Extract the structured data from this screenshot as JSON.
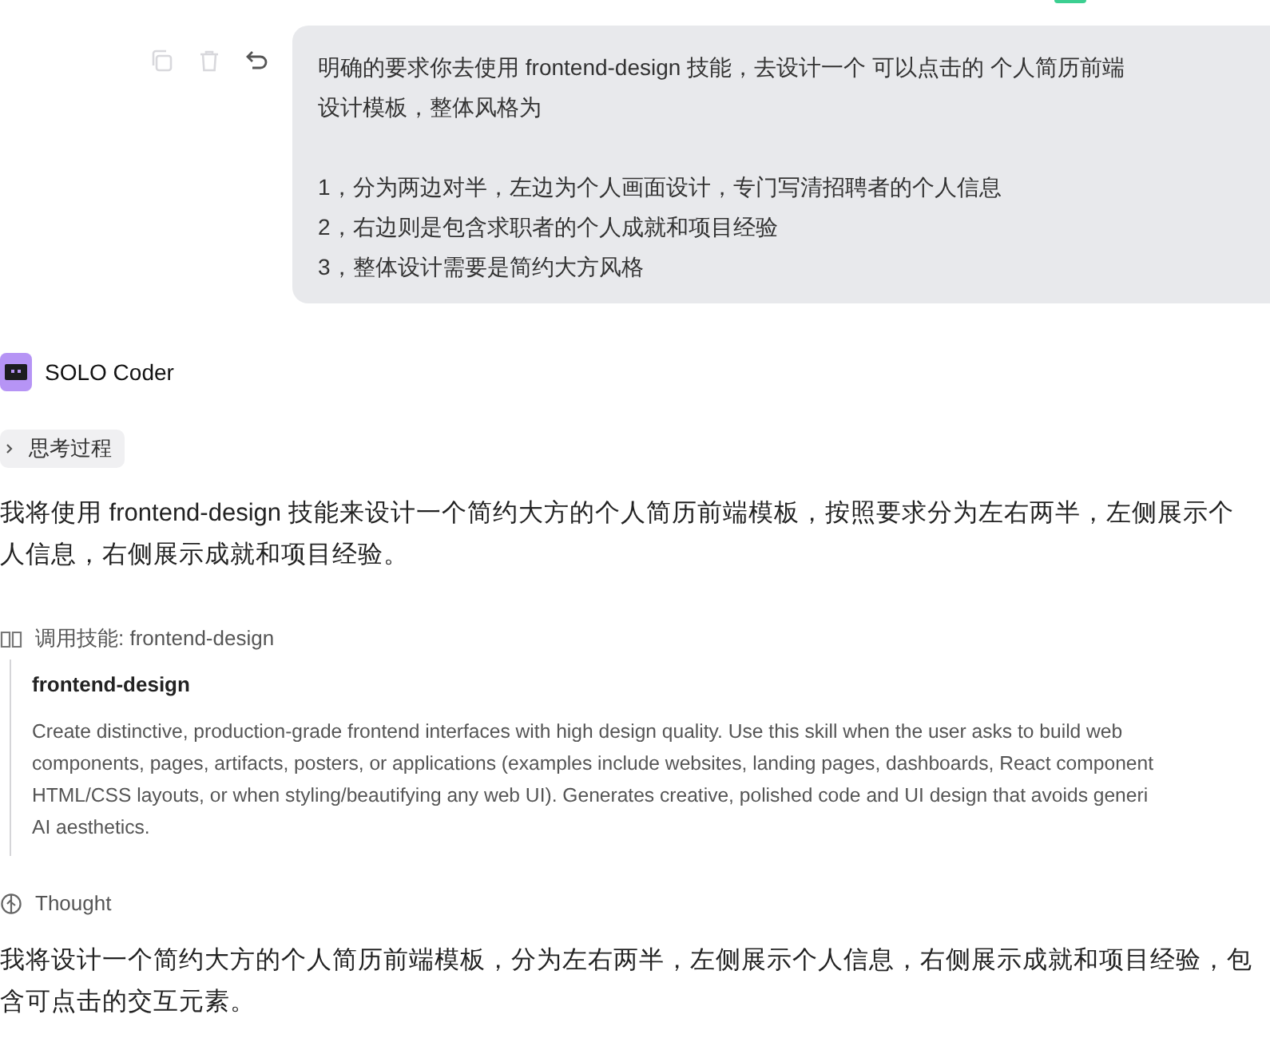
{
  "user_message": {
    "paragraphs": [
      [
        "明确的要求你去使用 frontend-design 技能，去设计一个 可以点击的 个人简历前端",
        "设计模板，整体风格为"
      ],
      [
        "1，分为两边对半，左边为个人画面设计，专门写清招聘者的个人信息",
        "2，右边则是包含求职者的个人成就和项目经验",
        "3，整体设计需要是简约大方风格"
      ]
    ]
  },
  "agent": {
    "name": "SOLO Coder"
  },
  "thinking": {
    "label": "思考过程",
    "expanded": false
  },
  "intro": {
    "lines": [
      "我将使用 frontend-design 技能来设计一个简约大方的个人简历前端模板，按照要求分为左右两半，左侧展示个",
      "人信息，右侧展示成就和项目经验。"
    ]
  },
  "skill_call": {
    "label": "调用技能: frontend-design",
    "title": "frontend-design",
    "description_lines": [
      "Create distinctive, production-grade frontend interfaces with high design quality. Use this skill when the user asks to build web",
      "components, pages, artifacts, posters, or applications (examples include websites, landing pages, dashboards, React component",
      "HTML/CSS layouts, or when styling/beautifying any web UI). Generates creative, polished code and UI design that avoids generi",
      "AI aesthetics."
    ]
  },
  "thought": {
    "label": "Thought"
  },
  "reply": {
    "lines": [
      "我将设计一个简约大方的个人简历前端模板，分为左右两半，左侧展示个人信息，右侧展示成就和项目经验，包",
      "含可点击的交互元素。"
    ]
  }
}
